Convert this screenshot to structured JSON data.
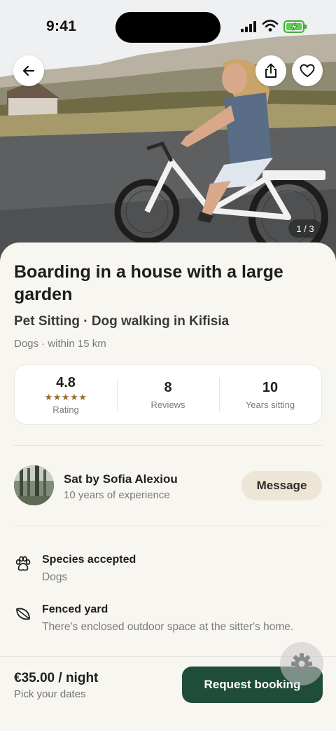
{
  "status_bar": {
    "time": "9:41"
  },
  "hero": {
    "counter": "1 / 3"
  },
  "listing": {
    "title": "Boarding in a house with a large garden",
    "subtitle": "Pet Sitting · Dog walking in Kifisia",
    "meta": "Dogs · within 15 km"
  },
  "stats": [
    {
      "value": "4.8",
      "stars": "★★★★★",
      "label": "Rating"
    },
    {
      "value": "8",
      "label": "Reviews"
    },
    {
      "value": "10",
      "label": "Years sitting"
    }
  ],
  "host": {
    "name": "Sat by Sofia Alexiou",
    "experience": "10 years of experience",
    "message_label": "Message"
  },
  "features": [
    {
      "icon": "paw-icon",
      "title": "Species accepted",
      "desc": "Dogs"
    },
    {
      "icon": "leaf-icon",
      "title": "Fenced yard",
      "desc": "There's enclosed outdoor space at the sitter's home."
    }
  ],
  "booking": {
    "price": "€35.00 / night",
    "dates": "Pick your dates",
    "button_label": "Request booking"
  },
  "colors": {
    "primary": "#1f4d3a",
    "message_bg": "#ede5d6",
    "star": "#9a6b2f",
    "background": "#f8f6f1"
  }
}
